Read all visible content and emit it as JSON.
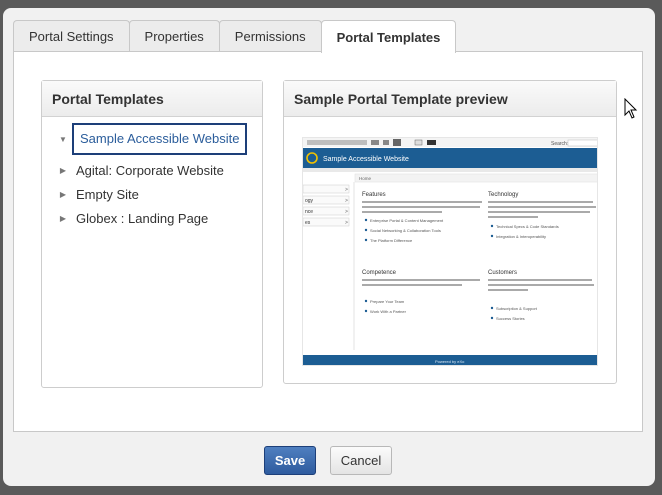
{
  "tabs": [
    {
      "label": "Portal Settings",
      "active": false
    },
    {
      "label": "Properties",
      "active": false
    },
    {
      "label": "Permissions",
      "active": false
    },
    {
      "label": "Portal Templates",
      "active": true
    }
  ],
  "templates_panel": {
    "title": "Portal Templates",
    "items": [
      {
        "label": "Sample Accessible Website",
        "selected": true,
        "expanded": true
      },
      {
        "label": "Agital: Corporate Website",
        "selected": false,
        "expanded": false
      },
      {
        "label": "Empty Site",
        "selected": false,
        "expanded": false
      },
      {
        "label": "Globex : Landing Page",
        "selected": false,
        "expanded": false
      }
    ]
  },
  "preview_panel": {
    "title": "Sample Portal Template preview",
    "thumbnail": {
      "site_title": "Sample Accessible Website",
      "breadcrumb": "Home",
      "search_label": "Search:",
      "footer_text": "Powered by eXo",
      "left_nav": [
        "",
        "ogy",
        "nce",
        "es"
      ],
      "sections": [
        {
          "heading": "Features",
          "bullets": [
            "Enterprise Portal & Content Management",
            "Social Networking & Collaboration Tools",
            "The Platform Difference"
          ]
        },
        {
          "heading": "Technology",
          "bullets": [
            "Technical Specs & Code Standards",
            "Integration & Interoperability"
          ]
        },
        {
          "heading": "Competence",
          "bullets": [
            "Prepare Your Team",
            "Work With a Partner"
          ]
        },
        {
          "heading": "Customers",
          "bullets": [
            "Subscription & Support",
            "Success Stories"
          ]
        }
      ]
    }
  },
  "buttons": {
    "save": "Save",
    "cancel": "Cancel"
  },
  "colors": {
    "accent": "#2b5d9b",
    "preview_header": "#1c5d93",
    "save_bg": "#3b68aa"
  }
}
